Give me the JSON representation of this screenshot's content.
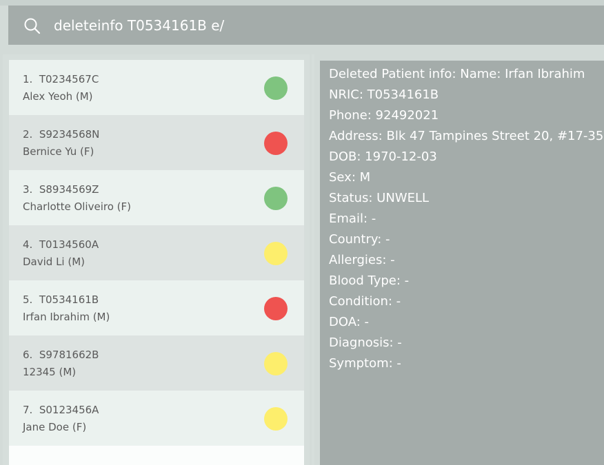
{
  "search": {
    "value": "deleteinfo T0534161B e/",
    "icon": "search-icon"
  },
  "patients": [
    {
      "line1": "1.  T0234567C",
      "line2": "Alex Yeoh (M)",
      "status_color": "#7fc47f"
    },
    {
      "line1": "2.  S9234568N",
      "line2": "Bernice Yu (F)",
      "status_color": "#ef5350"
    },
    {
      "line1": "3.  S8934569Z",
      "line2": "Charlotte Oliveiro (F)",
      "status_color": "#7fc47f"
    },
    {
      "line1": "4.  T0134560A",
      "line2": "David Li (M)",
      "status_color": "#fdee6c"
    },
    {
      "line1": "5.  T0534161B",
      "line2": "Irfan Ibrahim (M)",
      "status_color": "#ef5350"
    },
    {
      "line1": "6.  S9781662B",
      "line2": "12345 (M)",
      "status_color": "#fdee6c"
    },
    {
      "line1": "7.  S0123456A",
      "line2": "Jane Doe (F)",
      "status_color": "#fdee6c"
    }
  ],
  "details": {
    "lines": [
      "Deleted Patient info: Name: Irfan Ibrahim",
      "NRIC: T0534161B",
      "Phone: 92492021",
      "Address: Blk 47 Tampines Street 20, #17-35",
      "DOB: 1970-12-03",
      "Sex: M",
      "Status: UNWELL",
      "Email: -",
      "Country: -",
      "Allergies: -",
      "Blood Type: -",
      "Condition: -",
      "DOA: -",
      "Diagnosis: -",
      "Symptom: -"
    ]
  }
}
